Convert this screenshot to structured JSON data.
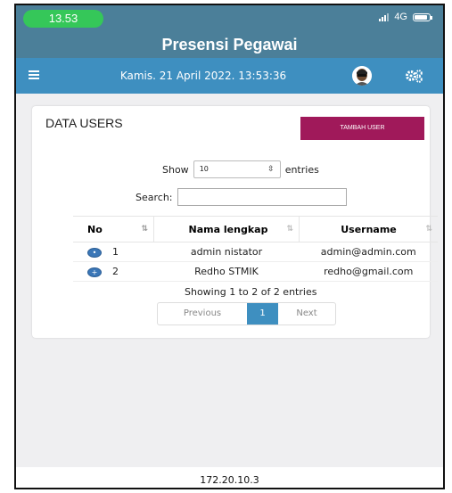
{
  "status": {
    "time": "13.53",
    "network": "4G"
  },
  "header": {
    "title": "Presensi Pegawai"
  },
  "navbar": {
    "datetime": "Kamis. 21 April 2022. 13:53:36"
  },
  "card": {
    "title": "DATA USERS",
    "add_button_label": "TAMBAH USER",
    "show_label": "Show",
    "page_length": "10",
    "entries_label": "entries",
    "search_label": "Search:",
    "search_value": ""
  },
  "table": {
    "headers": [
      "No",
      "Nama lengkap",
      "Username"
    ],
    "rows": [
      {
        "no": "1",
        "name": "admin nistator",
        "username": "admin@admin.com"
      },
      {
        "no": "2",
        "name": "Redho STMIK",
        "username": "redho@gmail.com"
      }
    ]
  },
  "pagination": {
    "info": "Showing 1 to 2 of 2 entries",
    "previous": "Previous",
    "current": "1",
    "next": "Next"
  },
  "browser": {
    "url": "172.20.10.3"
  },
  "colors": {
    "header_bg": "#4b7f99",
    "navbar_bg": "#3e8fc0",
    "add_button": "#a0195a",
    "status_pill": "#35c759"
  }
}
